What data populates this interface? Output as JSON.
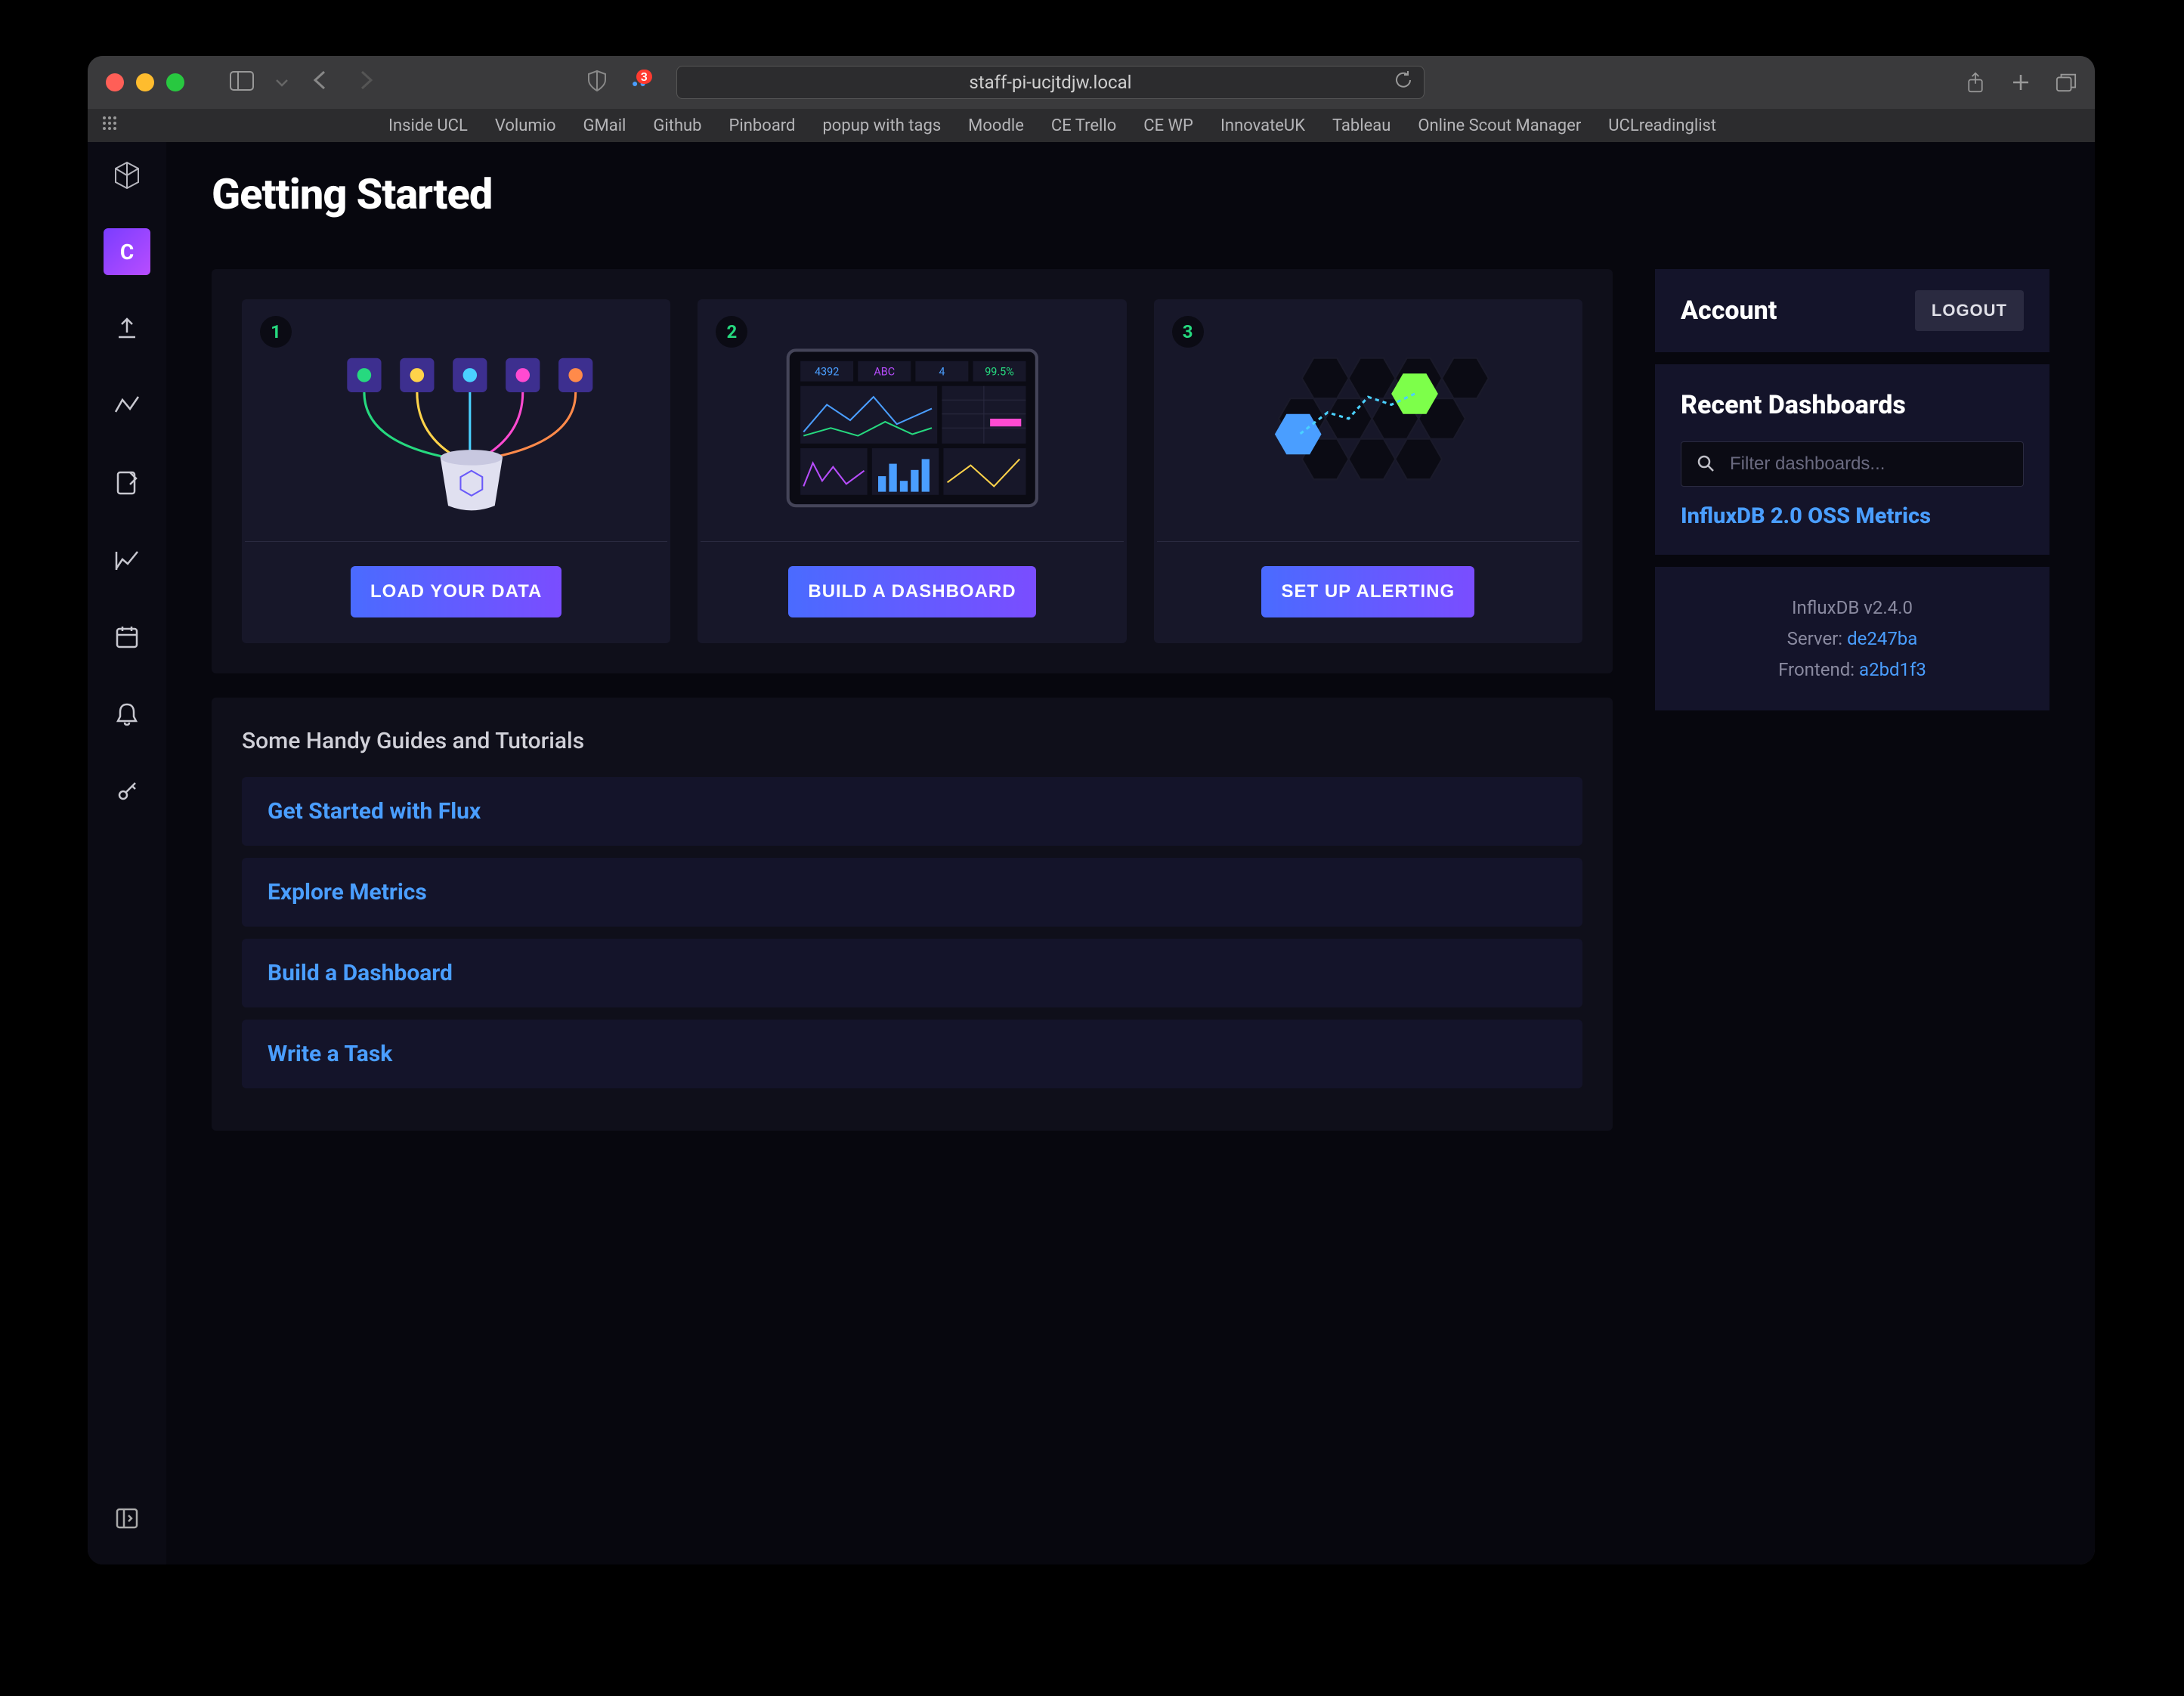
{
  "browser": {
    "url": "staff-pi-ucjtdjw.local",
    "badge": "3",
    "favorites": [
      "Inside UCL",
      "Volumio",
      "GMail",
      "Github",
      "Pinboard",
      "popup with tags",
      "Moodle",
      "CE Trello",
      "CE WP",
      "InnovateUK",
      "Tableau",
      "Online Scout Manager",
      "UCLreadinglist"
    ]
  },
  "sidebar": {
    "active_letter": "C"
  },
  "page": {
    "title": "Getting Started"
  },
  "cards": [
    {
      "num": "1",
      "btn": "LOAD YOUR DATA"
    },
    {
      "num": "2",
      "btn": "BUILD A DASHBOARD",
      "dash_labels": [
        "4392",
        "ABC",
        "4",
        "99.5%"
      ]
    },
    {
      "num": "3",
      "btn": "SET UP ALERTING"
    }
  ],
  "guides": {
    "title": "Some Handy Guides and Tutorials",
    "items": [
      "Get Started with Flux",
      "Explore Metrics",
      "Build a Dashboard",
      "Write a Task"
    ]
  },
  "account": {
    "title": "Account",
    "logout": "LOGOUT"
  },
  "recent": {
    "title": "Recent Dashboards",
    "filter_placeholder": "Filter dashboards...",
    "links": [
      "InfluxDB 2.0 OSS Metrics"
    ]
  },
  "version": {
    "product": "InfluxDB v2.4.0",
    "server_label": "Server: ",
    "server_hash": "de247ba",
    "frontend_label": "Frontend: ",
    "frontend_hash": "a2bd1f3"
  }
}
